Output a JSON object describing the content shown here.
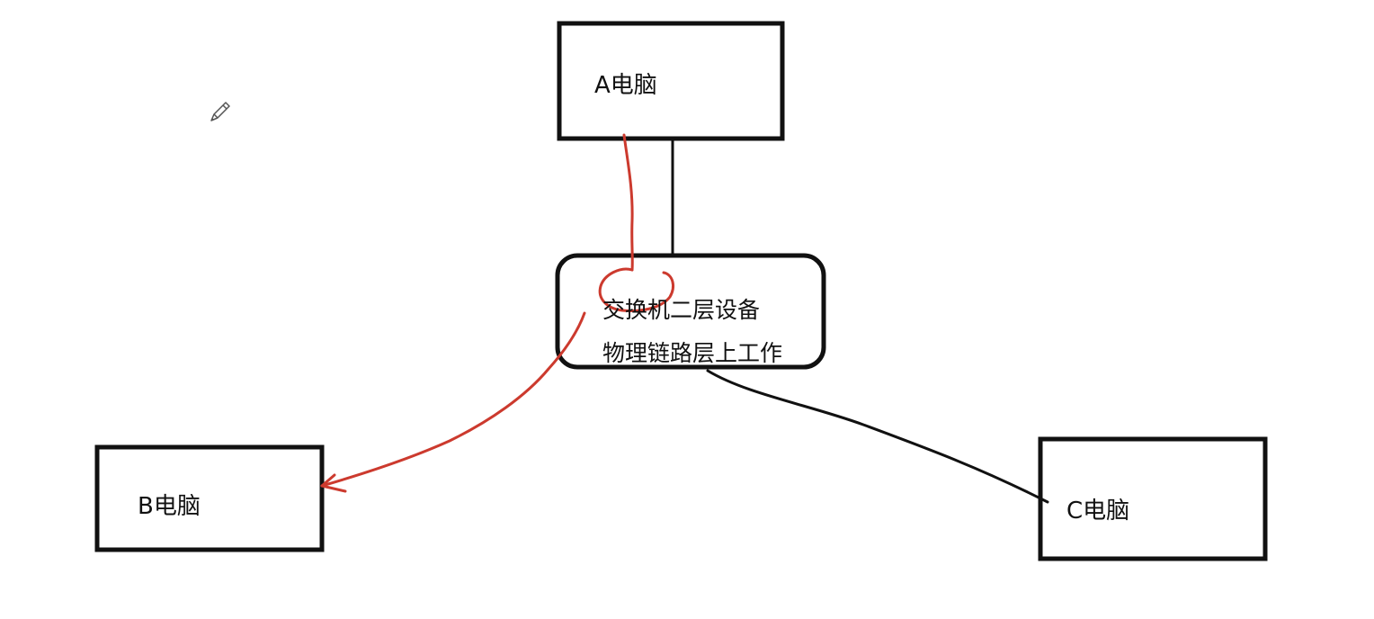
{
  "nodes": {
    "computer_a": {
      "label": "A电脑"
    },
    "computer_b": {
      "label": "B电脑"
    },
    "computer_c": {
      "label": "C电脑"
    },
    "switch": {
      "line1": "交换机二层设备",
      "line2": "物理链路层上工作"
    }
  },
  "colors": {
    "ink": "#111111",
    "annotation": "#cc3a2e",
    "background": "#ffffff"
  },
  "icons": {
    "cursor": "pencil-icon"
  }
}
